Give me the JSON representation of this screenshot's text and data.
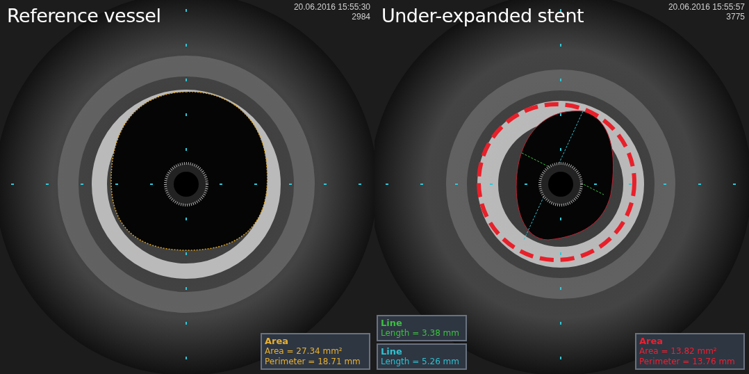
{
  "panels": [
    {
      "title": "Reference vessel",
      "timestamp": "20.06.2016 15:55:30",
      "frame": "2984",
      "stent_outline": false,
      "measurements": [
        {
          "kind": "area",
          "color": "#e8b030",
          "heading": "Area",
          "lines": [
            "Area = 27.34 mm²",
            "Perimeter = 18.71 mm"
          ]
        }
      ]
    },
    {
      "title": "Under-expanded stent",
      "timestamp": "20.06.2016 15:55:57",
      "frame": "3775",
      "stent_outline": true,
      "measurements": [
        {
          "kind": "line",
          "color": "#3cc040",
          "heading": "Line",
          "lines": [
            "Length = 3.38 mm"
          ]
        },
        {
          "kind": "line",
          "color": "#30c0d0",
          "heading": "Line",
          "lines": [
            "Length = 5.26 mm"
          ]
        },
        {
          "kind": "area",
          "color": "#ee2030",
          "heading": "Area",
          "lines": [
            "Area = 13.82 mm²",
            "Perimeter = 13.76 mm"
          ]
        }
      ]
    }
  ]
}
